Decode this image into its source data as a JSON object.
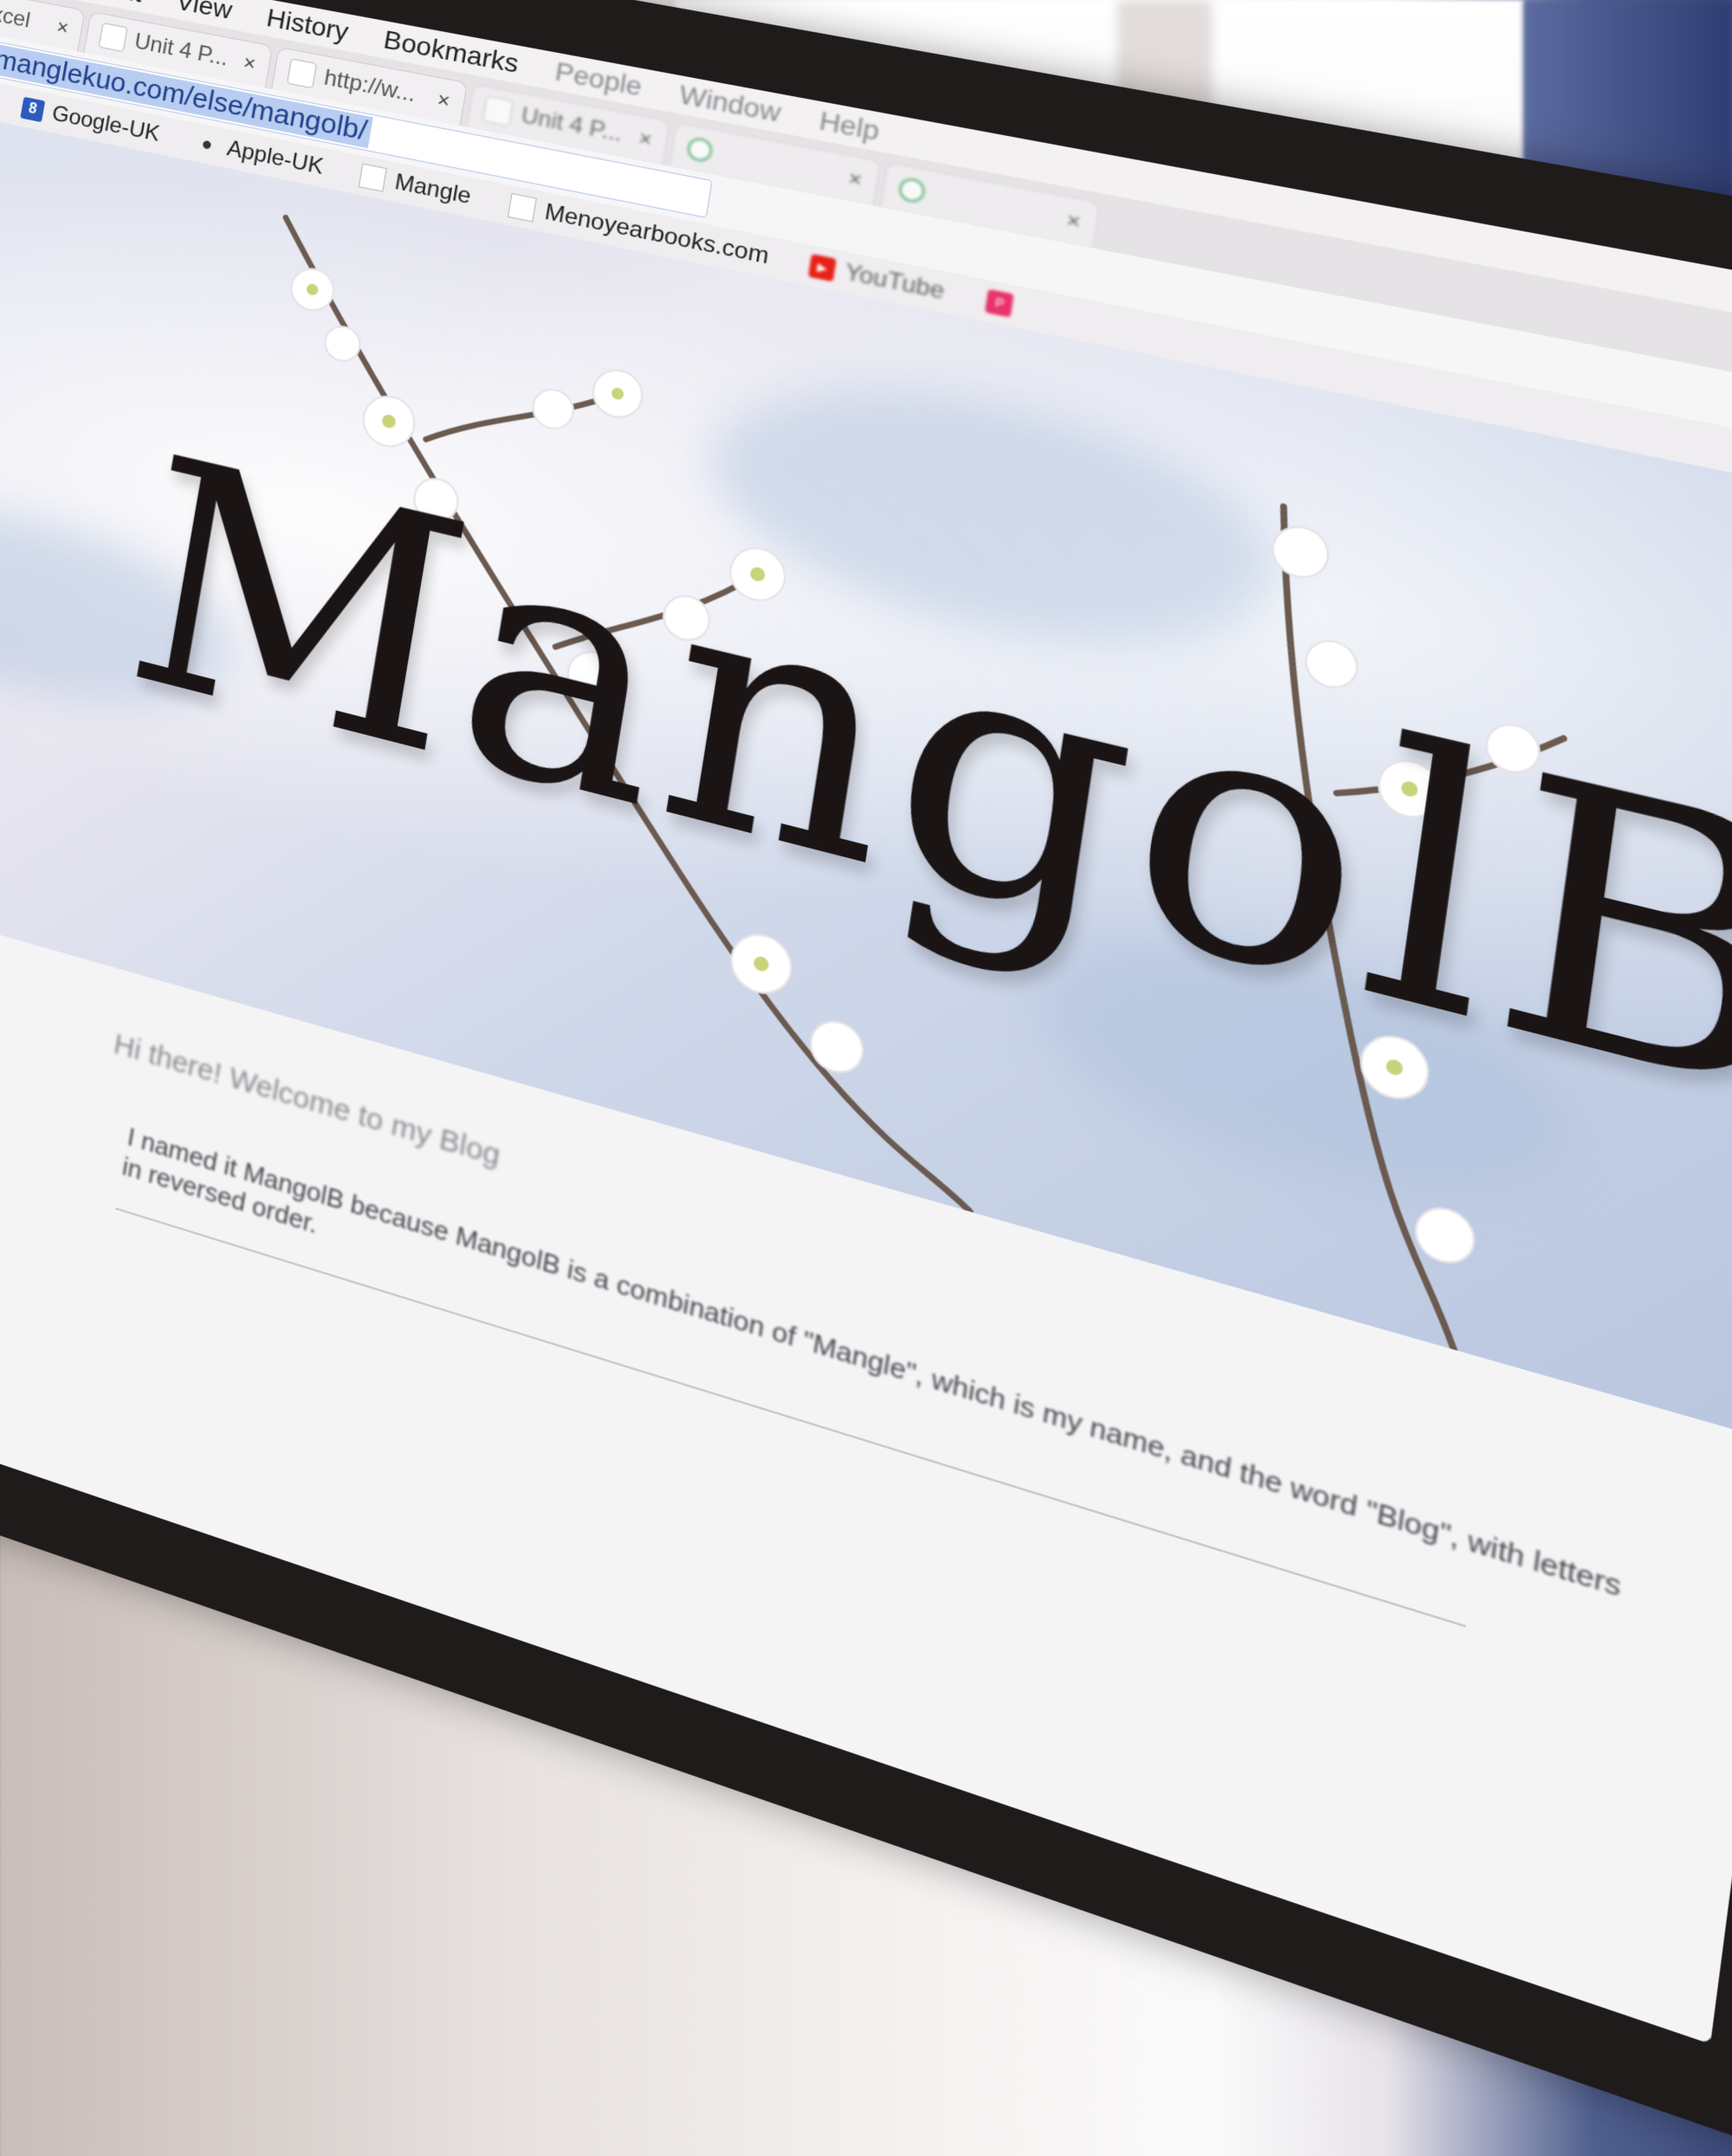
{
  "menu": {
    "items": [
      "Edit",
      "View",
      "History",
      "Bookmarks",
      "People",
      "Window",
      "Help"
    ]
  },
  "tabs": [
    {
      "label": "erdexcel",
      "icon": "google-icon"
    },
    {
      "label": "Unit 4 P...",
      "icon": "document-icon"
    },
    {
      "label": "http://w...",
      "icon": "document-icon"
    },
    {
      "label": "Unit 4 P...",
      "icon": "document-icon"
    },
    {
      "label": "",
      "icon": "google-drive-icon"
    },
    {
      "label": "",
      "icon": "google-drive-icon"
    }
  ],
  "address": {
    "url": "manglekuo.com/else/mangolb/"
  },
  "bookmarks": [
    {
      "label": "Google-UK",
      "icon": "google-icon"
    },
    {
      "label": "Apple-UK",
      "icon": "apple-icon"
    },
    {
      "label": "Mangle",
      "icon": "page-icon"
    },
    {
      "label": "Menoyearbooks.com",
      "icon": "page-icon"
    },
    {
      "label": "YouTube",
      "icon": "youtube-icon"
    },
    {
      "label": "",
      "icon": "pinterest-icon"
    }
  ],
  "hero": {
    "title": "MangolB"
  },
  "content": {
    "greeting": "Hi there! Welcome to my Blog",
    "intro": "I named it MangolB because MangolB is a combination of \"Mangle\", which is my name, and the word \"Blog\", with letters in reversed order."
  }
}
